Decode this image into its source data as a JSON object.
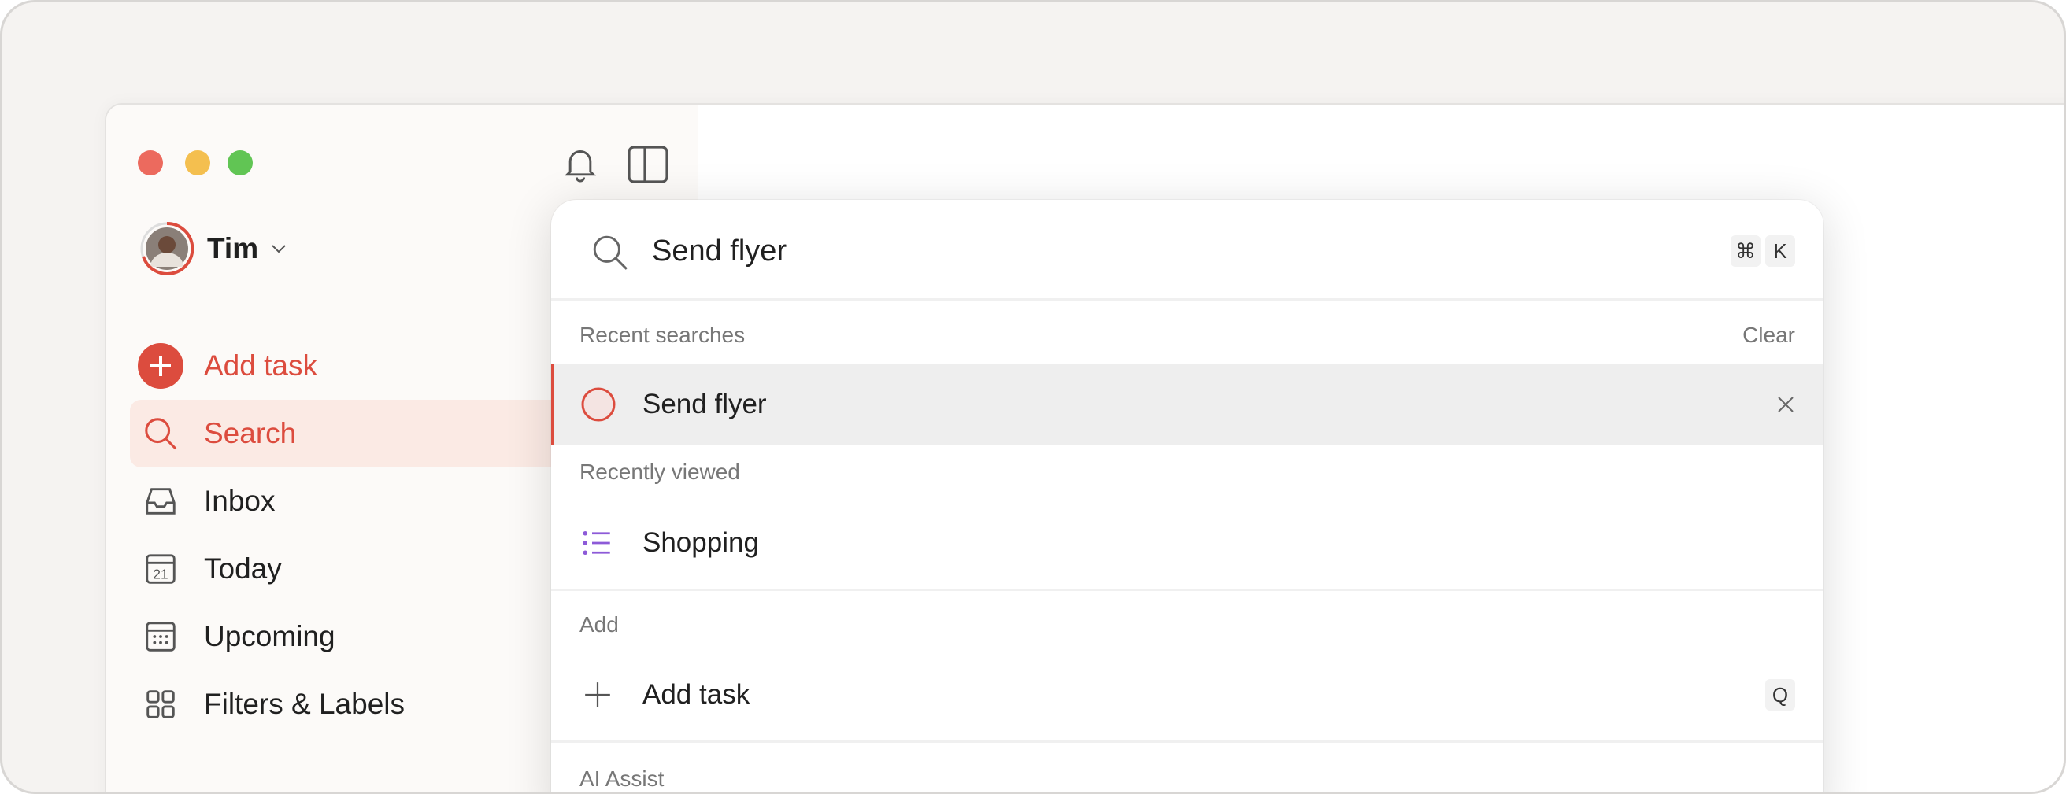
{
  "window": {
    "traffic_lights": {
      "close": "#ec6a5e",
      "minimize": "#f4bf4f",
      "zoom": "#61c554"
    }
  },
  "sidebar": {
    "user": {
      "name": "Tim"
    },
    "add_task": "Add task",
    "accent": "#dc4c3e",
    "items": [
      {
        "label": "Search",
        "icon": "search-icon",
        "active": true
      },
      {
        "label": "Inbox",
        "icon": "inbox-icon"
      },
      {
        "label": "Today",
        "icon": "calendar-today-icon",
        "day": "21"
      },
      {
        "label": "Upcoming",
        "icon": "calendar-grid-icon"
      },
      {
        "label": "Filters & Labels",
        "icon": "grid-icon"
      }
    ]
  },
  "search": {
    "query": "Send flyer",
    "shortcut": [
      "⌘",
      "K"
    ],
    "recent_title": "Recent searches",
    "clear": "Clear",
    "recent": [
      {
        "label": "Send flyer"
      }
    ],
    "recently_viewed_title": "Recently viewed",
    "recently_viewed": [
      {
        "label": "Shopping",
        "icon": "list-icon",
        "color": "#8d5ad8"
      }
    ],
    "add_title": "Add",
    "add_items": [
      {
        "label": "Add task",
        "shortcut": "Q"
      }
    ],
    "ai_title": "AI Assist"
  }
}
